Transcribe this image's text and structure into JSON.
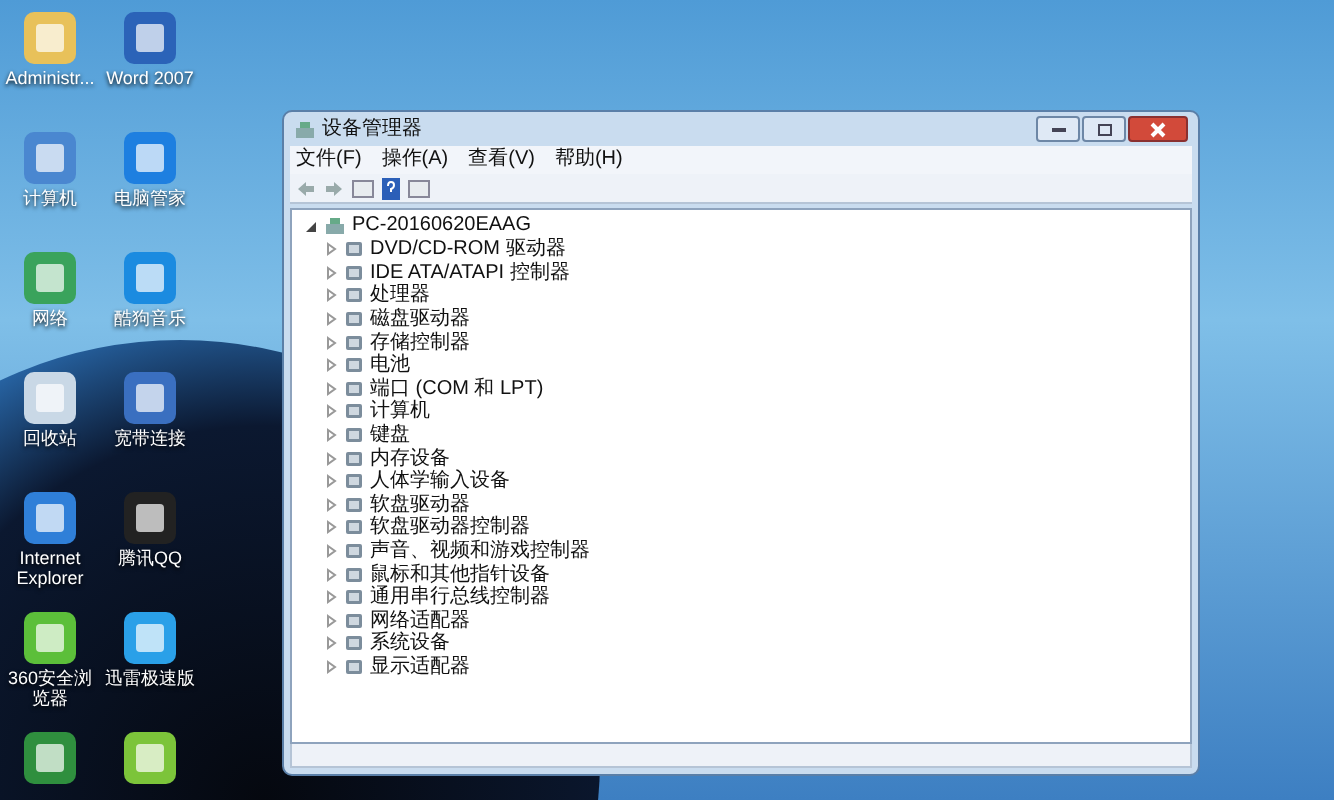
{
  "desktop_icons": [
    {
      "label": "Administr..."
    },
    {
      "label": "Word 2007"
    },
    {
      "label": "计算机"
    },
    {
      "label": "电脑管家"
    },
    {
      "label": "网络"
    },
    {
      "label": "酷狗音乐"
    },
    {
      "label": "回收站"
    },
    {
      "label": "宽带连接"
    },
    {
      "label": "Internet Explorer"
    },
    {
      "label": "腾讯QQ"
    },
    {
      "label": "360安全浏览器"
    },
    {
      "label": "迅雷极速版"
    },
    {
      "kind": "shortcut"
    },
    {
      "kind": "shortcut"
    }
  ],
  "window": {
    "title": "设备管理器",
    "menu": [
      "文件(F)",
      "操作(A)",
      "查看(V)",
      "帮助(H)"
    ],
    "tree": {
      "label": "PC-20160620EAAG",
      "expanded": true,
      "children": [
        {
          "label": "DVD/CD-ROM 驱动器",
          "expanded": false
        },
        {
          "label": "IDE ATA/ATAPI 控制器",
          "expanded": false
        },
        {
          "label": "处理器",
          "expanded": false
        },
        {
          "label": "磁盘驱动器",
          "expanded": false
        },
        {
          "label": "存储控制器",
          "expanded": false
        },
        {
          "label": "电池",
          "expanded": false
        },
        {
          "label": "端口 (COM 和 LPT)",
          "expanded": false
        },
        {
          "label": "计算机",
          "expanded": false
        },
        {
          "label": "键盘",
          "expanded": false
        },
        {
          "label": "内存设备",
          "expanded": false
        },
        {
          "label": "人体学输入设备",
          "expanded": false
        },
        {
          "label": "软盘驱动器",
          "expanded": false
        },
        {
          "label": "软盘驱动器控制器",
          "expanded": false
        },
        {
          "label": "声音、视频和游戏控制器",
          "expanded": false
        },
        {
          "label": "鼠标和其他指针设备",
          "expanded": false
        },
        {
          "label": "通用串行总线控制器",
          "expanded": false
        },
        {
          "label": "网络适配器",
          "expanded": false
        },
        {
          "label": "系统设备",
          "expanded": false
        },
        {
          "label": "显示适配器",
          "expanded": false
        }
      ]
    }
  }
}
